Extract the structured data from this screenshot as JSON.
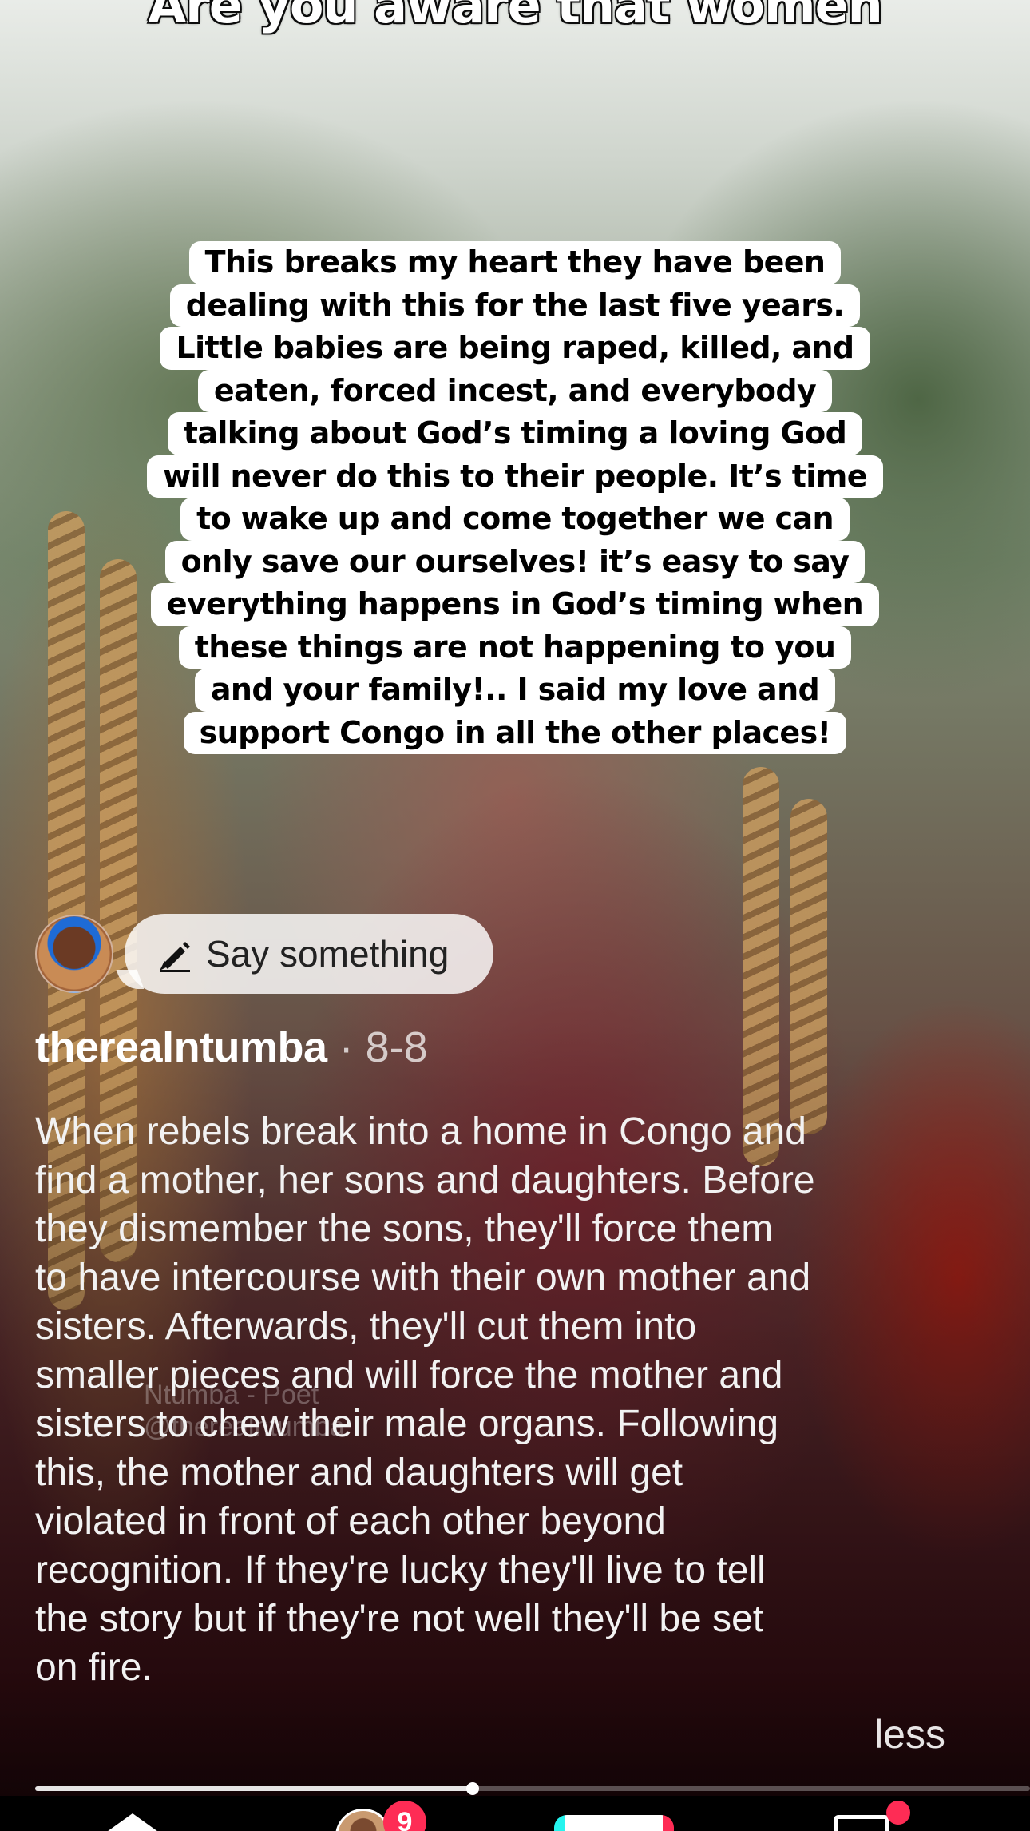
{
  "video": {
    "overlay_heading": "Are you aware that women",
    "caption_lines": [
      "This breaks my heart they have been",
      "dealing with this for the last five years.",
      "Little babies are being raped, killed, and",
      "eaten, forced incest, and everybody",
      "talking about God’s timing a loving God",
      "will never do this to their people. It’s time",
      "to wake up and come together we can",
      "only save our ourselves! it’s easy to say",
      "everything happens in God’s timing when",
      "these things are not happening to you",
      "and your family!.. I said my love and",
      "support Congo in all the other places!"
    ],
    "watermark": {
      "name": "Ntumba - Poet",
      "handle": "@therealntumba"
    }
  },
  "comment_prompt": {
    "placeholder": "Say something",
    "icon": "pencil-icon"
  },
  "post": {
    "author": "therealntumba",
    "separator": "·",
    "date": "8-8",
    "description": "When rebels break into a home in Congo and\nfind a mother, her sons and daughters. Before\nthey dismember the sons, they'll force them\nto have intercourse with their own mother and\nsisters. Afterwards, they'll cut them into\nsmaller pieces and will force the mother and\nsisters to chew their male organs. Following\nthis, the mother and daughters will get\nviolated in front of each other beyond\nrecognition. If they're lucky they'll live to tell\nthe story but if they're not well they'll be set\non fire.",
    "less_label": "less"
  },
  "playback": {
    "progress": 0.44
  },
  "bottom_nav": {
    "friends_badge": "9",
    "icons": [
      "home-icon",
      "friends-icon",
      "create-icon",
      "inbox-icon"
    ]
  },
  "colors": {
    "accent": "#fe2c55",
    "accent_secondary": "#25f4ee"
  }
}
